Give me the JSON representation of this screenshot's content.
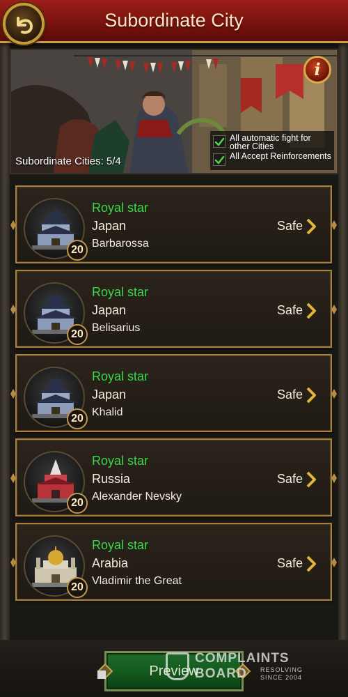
{
  "header": {
    "title": "Subordinate City",
    "back_icon": "back-arrow-icon"
  },
  "banner": {
    "subordinate_label": "Subordinate Cities: 5/4",
    "info_glyph": "i",
    "options": [
      {
        "label": "All automatic fight for other Cities",
        "checked": true
      },
      {
        "label": "All Accept Reinforcements",
        "checked": true
      }
    ]
  },
  "cities": [
    {
      "alliance": "Royal star",
      "country": "Japan",
      "lord": "Barbarossa",
      "level": "20",
      "status": "Safe",
      "icon": "japanese-castle-icon"
    },
    {
      "alliance": "Royal star",
      "country": "Japan",
      "lord": "Belisarius",
      "level": "20",
      "status": "Safe",
      "icon": "japanese-castle-icon"
    },
    {
      "alliance": "Royal star",
      "country": "Japan",
      "lord": "Khalid",
      "level": "20",
      "status": "Safe",
      "icon": "japanese-castle-icon"
    },
    {
      "alliance": "Royal star",
      "country": "Russia",
      "lord": "Alexander Nevsky",
      "level": "20",
      "status": "Safe",
      "icon": "russian-castle-icon"
    },
    {
      "alliance": "Royal star",
      "country": "Arabia",
      "lord": "Vladimir the Great",
      "level": "20",
      "status": "Safe",
      "icon": "arabian-palace-icon"
    }
  ],
  "footer": {
    "preview_label": "Preview"
  },
  "watermark": {
    "line1": "COMPLAINTS",
    "line2": "BOARD",
    "line3": "RESOLVING SINCE 2004"
  },
  "colors": {
    "header_red": "#7a130f",
    "gold_border": "#a8803c",
    "alliance_green": "#38d84a",
    "button_green": "#145a1e"
  }
}
